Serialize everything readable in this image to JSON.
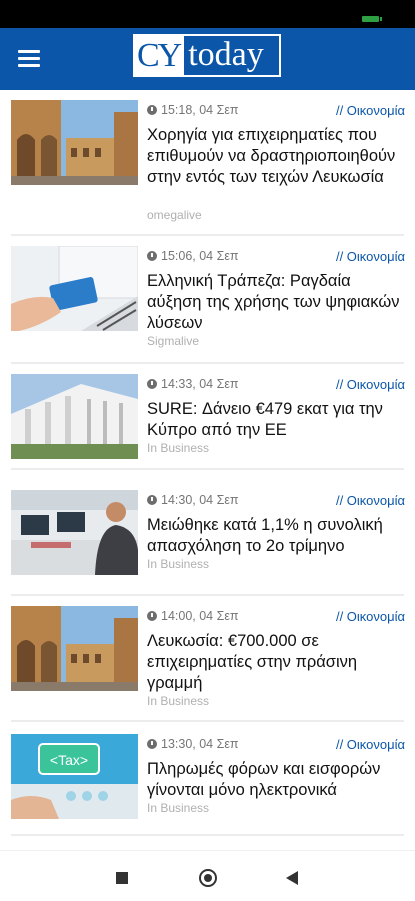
{
  "app": {
    "logo_cy": "CY",
    "logo_today": "today"
  },
  "articles": [
    {
      "time": "15:18, 04 Σεπ",
      "category": "// Οικονομία",
      "title": "Χορηγία για επιχειρηματίες που επιθυμούν να δραστηριοποιηθούν στην εντός των τειχών Λευκωσία",
      "source": "omegalive"
    },
    {
      "time": "15:06, 04 Σεπ",
      "category": "// Οικονομία",
      "title": "Ελληνική Τράπεζα: Ραγδαία αύξηση της χρήσης των ψηφιακών λύσεων",
      "source": "Sigmalive"
    },
    {
      "time": "14:33, 04 Σεπ",
      "category": "// Οικονομία",
      "title": "SURE: Δάνειο €479 εκατ για την Κύπρο από την ΕΕ",
      "source": "In Business"
    },
    {
      "time": "14:30, 04 Σεπ",
      "category": "// Οικονομία",
      "title": "Μειώθηκε κατά 1,1% η συνολική απασχόληση το 2ο τρίμηνο",
      "source": "In Business"
    },
    {
      "time": "14:00, 04 Σεπ",
      "category": "// Οικονομία",
      "title": "Λευκωσία: €700.000 σε επιχειρηματίες στην πράσινη γραμμή",
      "source": "In Business"
    },
    {
      "time": "13:30, 04 Σεπ",
      "category": "// Οικονομία",
      "title": "Πληρωμές φόρων και εισφορών γίνονται μόνο ηλεκτρονικά",
      "source": "In Business"
    }
  ],
  "thumb_text": {
    "tax": "<Tax>"
  }
}
